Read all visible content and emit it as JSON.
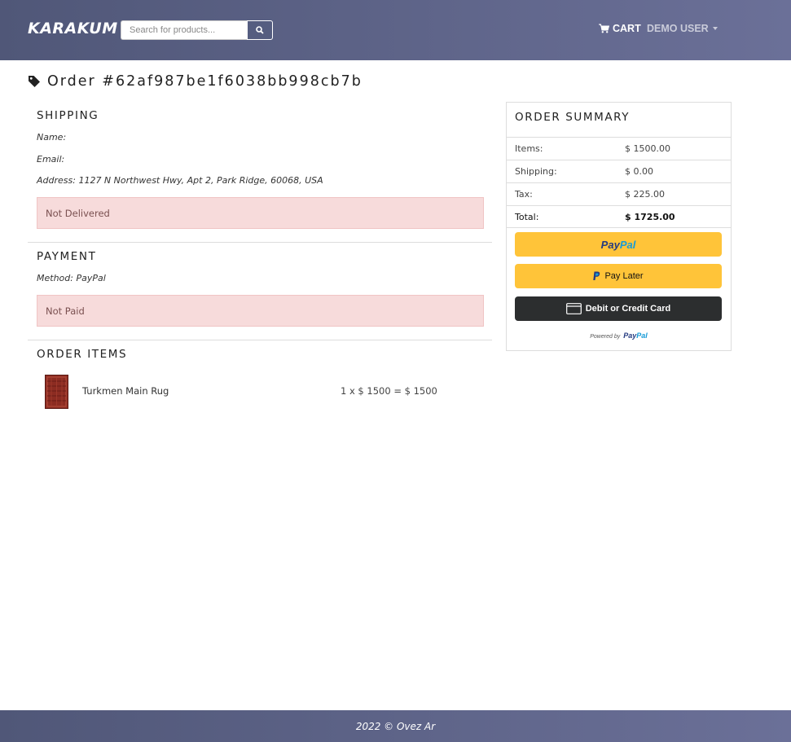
{
  "header": {
    "brand": "KARAKUM",
    "search_placeholder": "Search for products...",
    "cart_label": "CART",
    "user_label": "DEMO USER"
  },
  "order": {
    "title": "Order #62af987be1f6038bb998cb7b"
  },
  "shipping": {
    "heading": "SHIPPING",
    "name": "Name:",
    "email": "Email:",
    "address": "Address: 1127 N Northwest Hwy, Apt 2, Park Ridge, 60068, USA",
    "status": "Not Delivered"
  },
  "payment": {
    "heading": "PAYMENT",
    "method": "Method: PayPal",
    "status": "Not Paid"
  },
  "items": {
    "heading": "ORDER ITEMS",
    "list": [
      {
        "name": "Turkmen Main Rug",
        "price_line": "1 x $ 1500 = $ 1500"
      }
    ]
  },
  "summary": {
    "heading": "ORDER SUMMARY",
    "rows": [
      {
        "label": "Items:",
        "value": "$ 1500.00"
      },
      {
        "label": "Shipping:",
        "value": "$ 0.00"
      },
      {
        "label": "Tax:",
        "value": "$ 225.00"
      },
      {
        "label": "Total:",
        "value": "$ 1725.00"
      }
    ],
    "paypal_label_pay": "Pay",
    "paypal_label_pal": "Pal",
    "pay_later_label": "Pay Later",
    "card_label": "Debit or Credit Card",
    "powered_by": "Powered by",
    "powered_brand_pay": "Pay",
    "powered_brand_pal": "Pal"
  },
  "footer": {
    "text": "2022 © Ovez Ar"
  },
  "colors": {
    "navbar": "#5a6186",
    "alert_bg": "#f7dbdb",
    "paypal_gold": "#ffc439",
    "card_dark": "#2c2e2f",
    "paypal_navy": "#253b80",
    "paypal_blue": "#179bd7"
  }
}
